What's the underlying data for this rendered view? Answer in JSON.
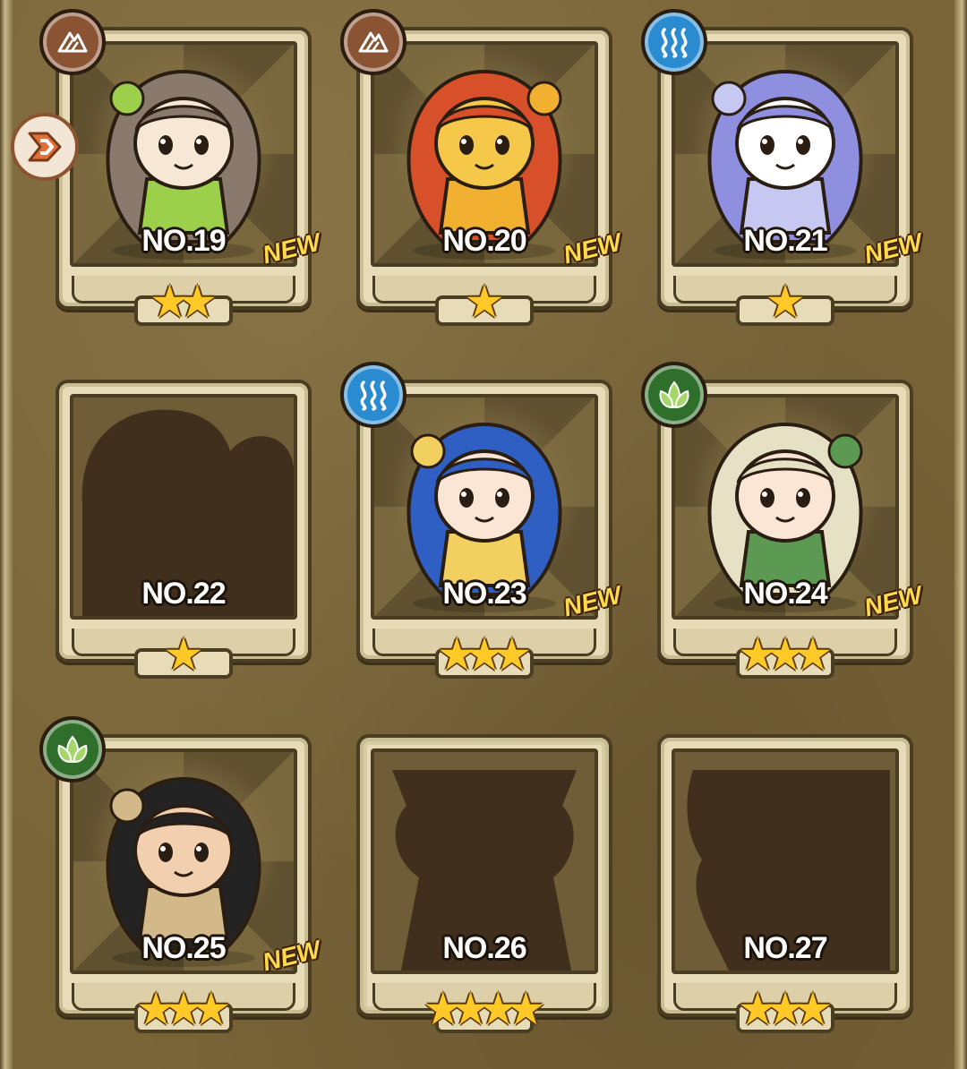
{
  "cards": [
    {
      "number": "NO.19",
      "element": "earth-icon",
      "stars": "★★",
      "is_new": true,
      "new_label": "NEW",
      "unlocked": true,
      "palette": {
        "hair": "#8a7a6e",
        "accent": "#9ccf4a",
        "skin": "#f7e8d6"
      }
    },
    {
      "number": "NO.20",
      "element": "earth-icon",
      "stars": "★",
      "is_new": true,
      "new_label": "NEW",
      "unlocked": true,
      "palette": {
        "hair": "#d8502a",
        "accent": "#f2b030",
        "skin": "#f5c84a"
      }
    },
    {
      "number": "NO.21",
      "element": "water-icon",
      "stars": "★",
      "is_new": true,
      "new_label": "NEW",
      "unlocked": true,
      "palette": {
        "hair": "#8f8fe0",
        "accent": "#c6c8f2",
        "skin": "#ffffff"
      }
    },
    {
      "number": "NO.22",
      "element": "",
      "stars": "★",
      "is_new": false,
      "new_label": "",
      "unlocked": false
    },
    {
      "number": "NO.23",
      "element": "water-icon",
      "stars": "★★★",
      "is_new": true,
      "new_label": "NEW",
      "unlocked": true,
      "palette": {
        "hair": "#2f5fc2",
        "accent": "#f2d060",
        "skin": "#fbe6d6"
      }
    },
    {
      "number": "NO.24",
      "element": "wood-icon",
      "stars": "★★★",
      "is_new": true,
      "new_label": "NEW",
      "unlocked": true,
      "palette": {
        "hair": "#e6e0c4",
        "accent": "#5c9a54",
        "skin": "#fbe6d6"
      }
    },
    {
      "number": "NO.25",
      "element": "wood-icon",
      "stars": "★★★",
      "is_new": true,
      "new_label": "NEW",
      "unlocked": true,
      "palette": {
        "hair": "#232323",
        "accent": "#d3b88a",
        "skin": "#f2cfae"
      }
    },
    {
      "number": "NO.26",
      "element": "",
      "stars": "★★★★",
      "is_new": false,
      "new_label": "",
      "unlocked": false
    },
    {
      "number": "NO.27",
      "element": "",
      "stars": "★★★",
      "is_new": false,
      "new_label": "",
      "unlocked": false
    }
  ],
  "skill_badge": {
    "icon": "skill-arrow-icon"
  }
}
